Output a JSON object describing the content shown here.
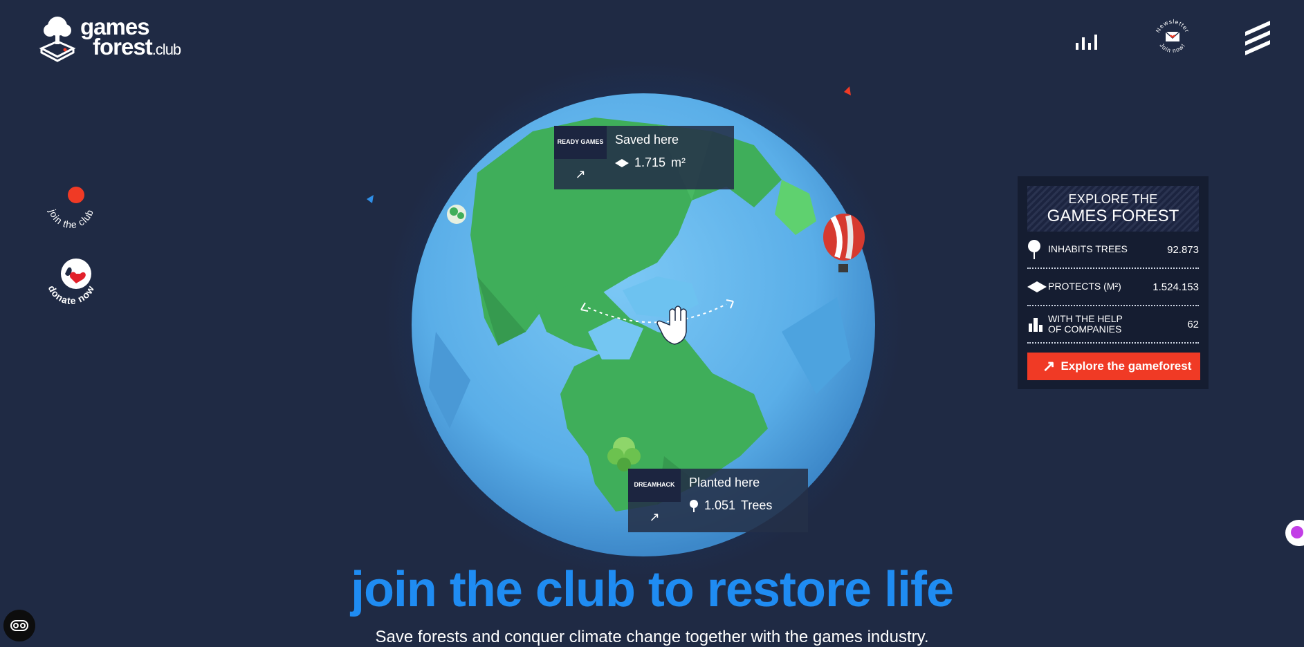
{
  "brand": {
    "line1": "games",
    "line2": "forest",
    "suffix": ".club"
  },
  "top_icons": {
    "stats": "bar-chart-icon",
    "newsletter": "newsletter-badge",
    "menu": "hamburger-menu-icon"
  },
  "newsletter_badge": {
    "top": "Newsletter",
    "bottom": "Join now!"
  },
  "side_badges": {
    "join": "join the club",
    "donate": "donate now"
  },
  "globe_tooltips": {
    "saved": {
      "company": "READY GAMES",
      "title": "Saved here",
      "value": "1.715",
      "unit": "m²"
    },
    "planted": {
      "company": "DREAMHACK",
      "title": "Planted here",
      "value": "1.051",
      "unit": "Trees"
    }
  },
  "explore": {
    "heading_line1": "EXPLORE THE",
    "heading_line2": "GAMES FOREST",
    "stats": [
      {
        "icon": "tree-icon",
        "label": "INHABITS TREES",
        "value": "92.873"
      },
      {
        "icon": "area-icon",
        "label": "PROTECTS (M²)",
        "value": "1.524.153"
      },
      {
        "icon": "companies-icon",
        "label_line1": "WITH THE HELP",
        "label_line2": "OF COMPANIES",
        "value": "62"
      }
    ],
    "button": "Explore the gameforest"
  },
  "hero": {
    "title": "join the club to restore life",
    "subtitle": "Save forests and conquer climate change together with the games industry."
  },
  "colors": {
    "background": "#1f2a44",
    "accent": "#f03a25",
    "title_blue": "#1f8cf2",
    "land": "#3fae5a",
    "ocean": "#5ab6f0"
  }
}
